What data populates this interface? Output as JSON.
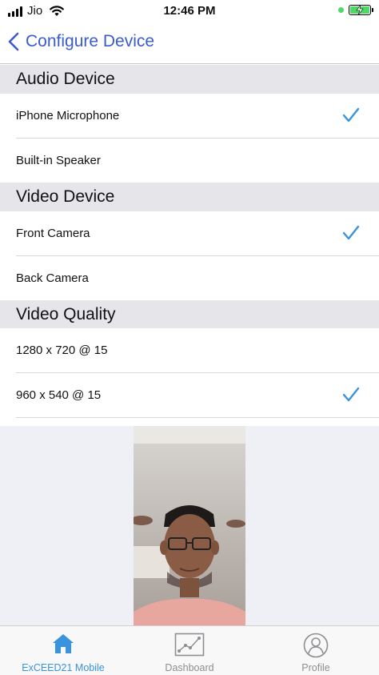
{
  "status_bar": {
    "carrier": "Jio",
    "time": "12:46 PM",
    "icons": [
      "signal-icon",
      "wifi-icon",
      "battery-charging-icon"
    ]
  },
  "nav": {
    "title": "Configure Device",
    "back_icon": "chevron-left-icon"
  },
  "audio": {
    "header": "Audio Device",
    "items": [
      {
        "label": "iPhone Microphone",
        "selected": true
      },
      {
        "label": "Built-in Speaker",
        "selected": false
      }
    ]
  },
  "video": {
    "header": "Video Device",
    "items": [
      {
        "label": "Front Camera",
        "selected": true
      },
      {
        "label": "Back Camera",
        "selected": false
      }
    ]
  },
  "quality": {
    "header": "Video Quality",
    "items": [
      {
        "label": "1280 x 720 @ 15",
        "selected": false
      },
      {
        "label": "960 x 540 @ 15",
        "selected": true
      }
    ]
  },
  "tabs": [
    {
      "label": "ExCEED21 Mobile",
      "icon": "home-icon",
      "active": true
    },
    {
      "label": "Dashboard",
      "icon": "chart-icon",
      "active": false
    },
    {
      "label": "Profile",
      "icon": "profile-icon",
      "active": false
    }
  ],
  "colors": {
    "accent": "#3a93dd",
    "nav_tint": "#3a5ccc",
    "section_bg": "#e5e5ea",
    "battery": "#4cd964"
  }
}
